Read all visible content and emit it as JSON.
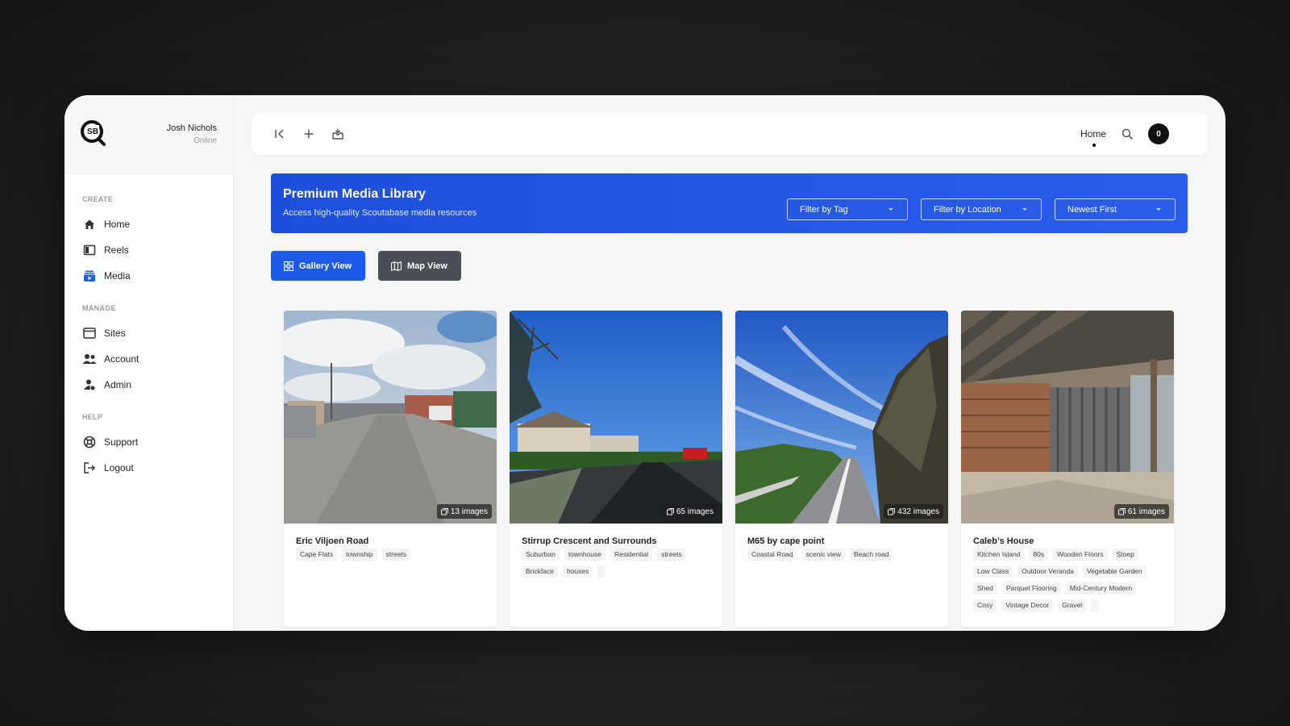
{
  "user": {
    "name": "Josh Nichols",
    "status": "Online"
  },
  "sidebar": {
    "sections": [
      {
        "label": "CREATE",
        "items": [
          {
            "label": "Home",
            "icon": "home-icon"
          },
          {
            "label": "Reels",
            "icon": "reels-icon"
          },
          {
            "label": "Media",
            "icon": "media-icon"
          }
        ]
      },
      {
        "label": "MANAGE",
        "items": [
          {
            "label": "Sites",
            "icon": "sites-icon"
          },
          {
            "label": "Account",
            "icon": "account-icon"
          },
          {
            "label": "Admin",
            "icon": "admin-icon"
          }
        ]
      },
      {
        "label": "HELP",
        "items": [
          {
            "label": "Support",
            "icon": "support-icon"
          },
          {
            "label": "Logout",
            "icon": "logout-icon"
          }
        ]
      }
    ]
  },
  "topbar": {
    "home_label": "Home",
    "notification_count": "0"
  },
  "banner": {
    "title": "Premium Media Library",
    "subtitle": "Access high-quality Scoutabase media resources",
    "filters": [
      "Filter by Tag",
      "Filter by Location",
      "Newest First"
    ]
  },
  "views": {
    "gallery_label": "Gallery View",
    "map_label": "Map View"
  },
  "cards": [
    {
      "title": "Eric Viljoen Road",
      "count": "13 images",
      "tags": [
        "Cape Flats",
        "township",
        "streets"
      ]
    },
    {
      "title": "Stirrup Crescent and Surrounds",
      "count": "65 images",
      "tags": [
        "Suburban",
        "townhouse",
        "Residential",
        "streets",
        "Brickface",
        "houses",
        ""
      ]
    },
    {
      "title": "M65 by cape point",
      "count": "432 images",
      "tags": [
        "Coastal Road",
        "scenic view",
        "Beach road"
      ]
    },
    {
      "title": "Caleb's House",
      "count": "61 images",
      "tags": [
        "Kitchen Island",
        "80s",
        "Wooden Floors",
        "Stoep",
        "Low Class",
        "Outdoor Veranda",
        "Vegetable Garden",
        "Shed",
        "Parquet Flooring",
        "Mid-Century Modern",
        "Cosy",
        "Vintage Decor",
        "Gravel",
        ""
      ]
    }
  ],
  "colors": {
    "accent": "#1e4fdb",
    "map_button": "#4a4e55",
    "page_bg": "#f6f6f6"
  }
}
